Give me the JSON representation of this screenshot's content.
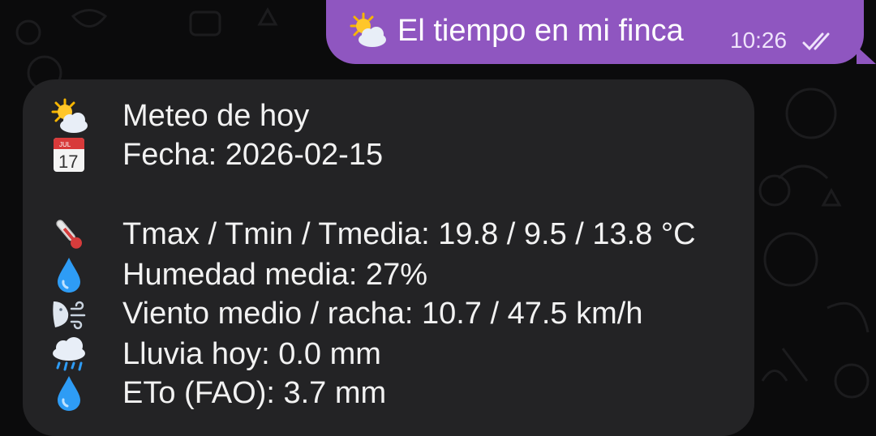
{
  "outgoing": {
    "text": "El tiempo en mi finca",
    "time": "10:26",
    "status_icon": "double-check-read-icon",
    "emoji": "sun-behind-cloud-icon"
  },
  "incoming": {
    "lines": [
      {
        "icon": "sun-behind-cloud-icon",
        "text": "Meteo de hoy"
      },
      {
        "icon": "calendar-icon",
        "text": "Fecha: 2026-02-15"
      },
      {
        "icon": "thermometer-icon",
        "text": "Tmax / Tmin / Tmedia: 19.8 / 9.5 / 13.8 °C"
      },
      {
        "icon": "droplet-icon",
        "text": "Humedad media: 27%"
      },
      {
        "icon": "wind-face-icon",
        "text": "Viento medio / racha: 10.7 / 47.5 km/h"
      },
      {
        "icon": "rain-cloud-icon",
        "text": "Lluvia hoy: 0.0 mm"
      },
      {
        "icon": "droplet-icon",
        "text": "ETo (FAO): 3.7 mm"
      }
    ],
    "calendar_icon_text": {
      "month": "JUL",
      "day": "17"
    }
  },
  "colors": {
    "background": "#0b0b0c",
    "outgoing_bubble": "#8f56c0",
    "incoming_bubble": "#232325",
    "text": "#f2f2f2"
  }
}
